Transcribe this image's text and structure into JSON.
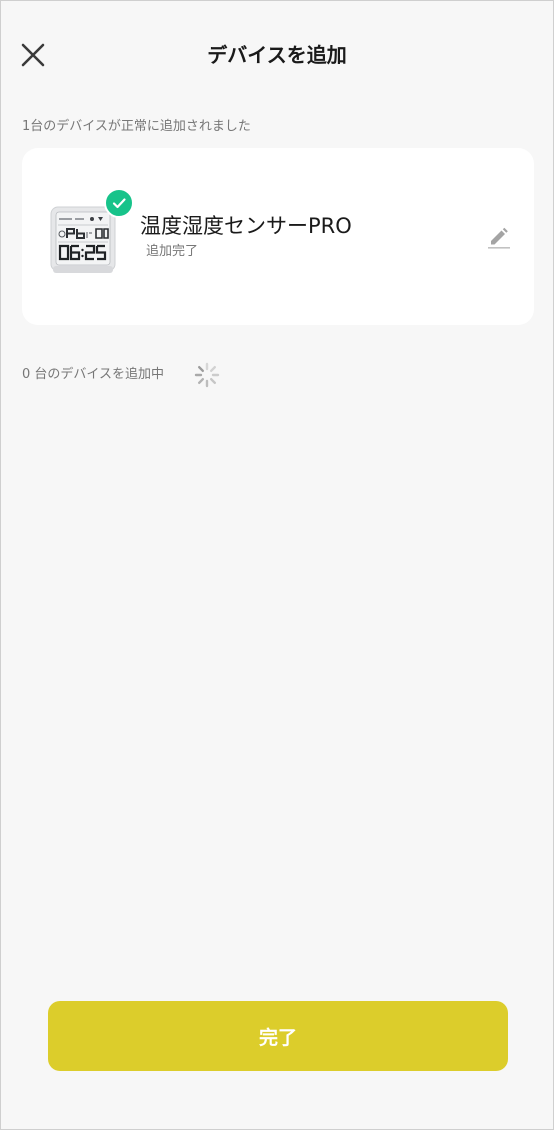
{
  "header": {
    "title": "デバイスを追加",
    "close_icon": "close-icon"
  },
  "success_section": {
    "label": "1台のデバイスが正常に追加されました",
    "devices": [
      {
        "name": "温度湿度センサーPRO",
        "status": "追加完了",
        "image_icon": "thermo-hygrometer-image",
        "badge_icon": "check-icon",
        "edit_icon": "pencil-icon",
        "display": {
          "temperature": "26",
          "humidity": "58",
          "time": "06:25"
        }
      }
    ]
  },
  "adding_section": {
    "label": "0 台のデバイスを追加中",
    "spinner_icon": "loading-spinner-icon"
  },
  "footer": {
    "done_label": "完了"
  },
  "colors": {
    "background": "#f7f7f7",
    "card": "#ffffff",
    "accent": "#dccd2b",
    "success": "#17c38a",
    "secondary_text": "#777777"
  }
}
